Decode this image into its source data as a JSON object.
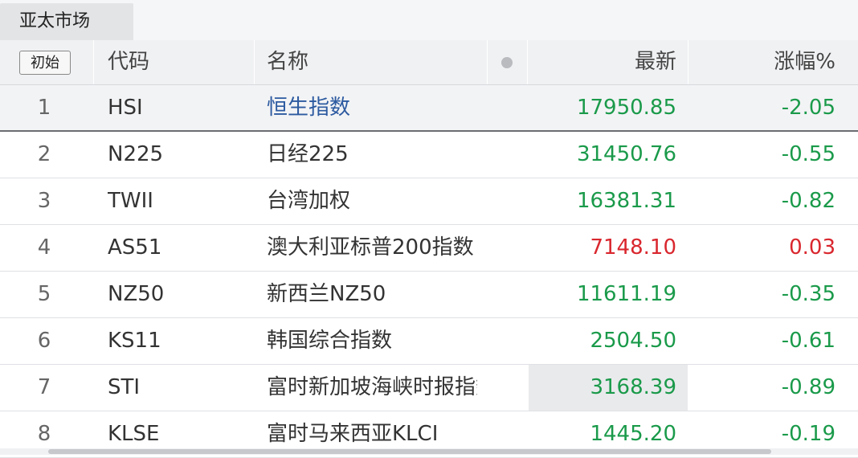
{
  "tab": {
    "label": "亚太市场"
  },
  "header": {
    "init_button": "初始",
    "code": "代码",
    "name": "名称",
    "last": "最新",
    "change_pct": "涨幅%"
  },
  "rows": [
    {
      "index": "1",
      "code": "HSI",
      "name": "恒生指数",
      "last": "17950.85",
      "change": "-2.05",
      "direction": "down"
    },
    {
      "index": "2",
      "code": "N225",
      "name": "日经225",
      "last": "31450.76",
      "change": "-0.55",
      "direction": "down"
    },
    {
      "index": "3",
      "code": "TWII",
      "name": "台湾加权",
      "last": "16381.31",
      "change": "-0.82",
      "direction": "down"
    },
    {
      "index": "4",
      "code": "AS51",
      "name": "澳大利亚标普200指数",
      "last": "7148.10",
      "change": "0.03",
      "direction": "up"
    },
    {
      "index": "5",
      "code": "NZ50",
      "name": "新西兰NZ50",
      "last": "11611.19",
      "change": "-0.35",
      "direction": "down"
    },
    {
      "index": "6",
      "code": "KS11",
      "name": "韩国综合指数",
      "last": "2504.50",
      "change": "-0.61",
      "direction": "down"
    },
    {
      "index": "7",
      "code": "STI",
      "name": "富时新加坡海峡时报指数",
      "last": "3168.39",
      "change": "-0.89",
      "direction": "down"
    },
    {
      "index": "8",
      "code": "KLSE",
      "name": "富时马来西亚KLCI",
      "last": "1445.20",
      "change": "-0.19",
      "direction": "down"
    }
  ],
  "colors": {
    "up": "#d9272e",
    "down": "#1a9a4a",
    "link": "#2c5aa0"
  }
}
